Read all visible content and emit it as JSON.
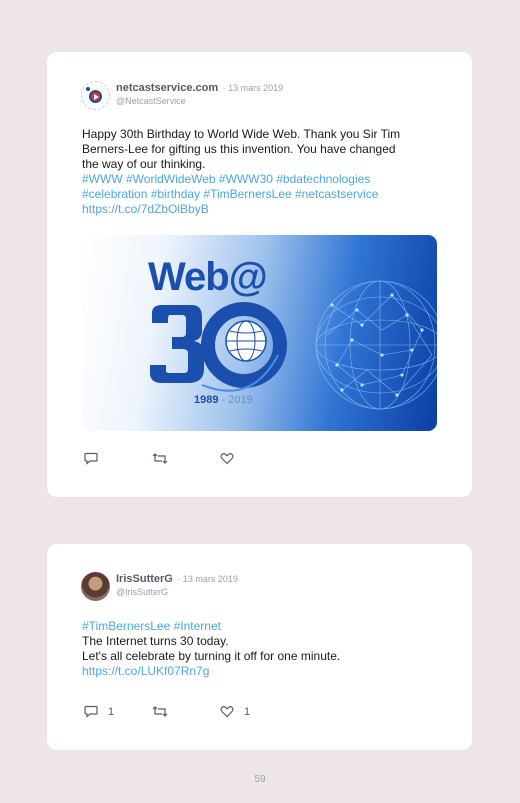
{
  "tweets": [
    {
      "display_name": "netcastservice.com",
      "date": "· 13 mars 2019",
      "handle": "@NetcastService",
      "text_lines": [
        "Happy 30th Birthday to World Wide Web. Thank you Sir Tim",
        "Berners-Lee for gifting us this invention. You have changed",
        "the way of our thinking."
      ],
      "link_lines": [
        "#WWW #WorldWideWeb #WWW30 #bdatechnologies",
        "#celebration #birthday #TimBernersLee #netcastservice",
        "https://t.co/7dZbOlBbyB"
      ],
      "image": {
        "title": "Web@",
        "year_start": "1989",
        "year_sep": " - ",
        "year_end": "2019"
      },
      "reply_count": "",
      "retweet_count": "",
      "like_count": ""
    },
    {
      "display_name": "IrisSutterG",
      "date": "· 13 mars 2019",
      "handle": "@IrisSutterG",
      "link_lines_top": [
        "#TimBernersLee #Internet"
      ],
      "text_lines": [
        "The Internet turns 30 today.",
        "Let's all celebrate by turning it off for one minute."
      ],
      "link_lines": [
        "https://t.co/LUKf07Rn7g"
      ],
      "reply_count": "1",
      "retweet_count": "",
      "like_count": "1"
    }
  ],
  "page_number": "59",
  "icons": {
    "reply": "reply-icon",
    "retweet": "retweet-icon",
    "like": "like-icon"
  },
  "colors": {
    "link": "#4aa8e0",
    "background": "#ede5e6",
    "card": "#ffffff",
    "brand_blue": "#1a4fae"
  }
}
